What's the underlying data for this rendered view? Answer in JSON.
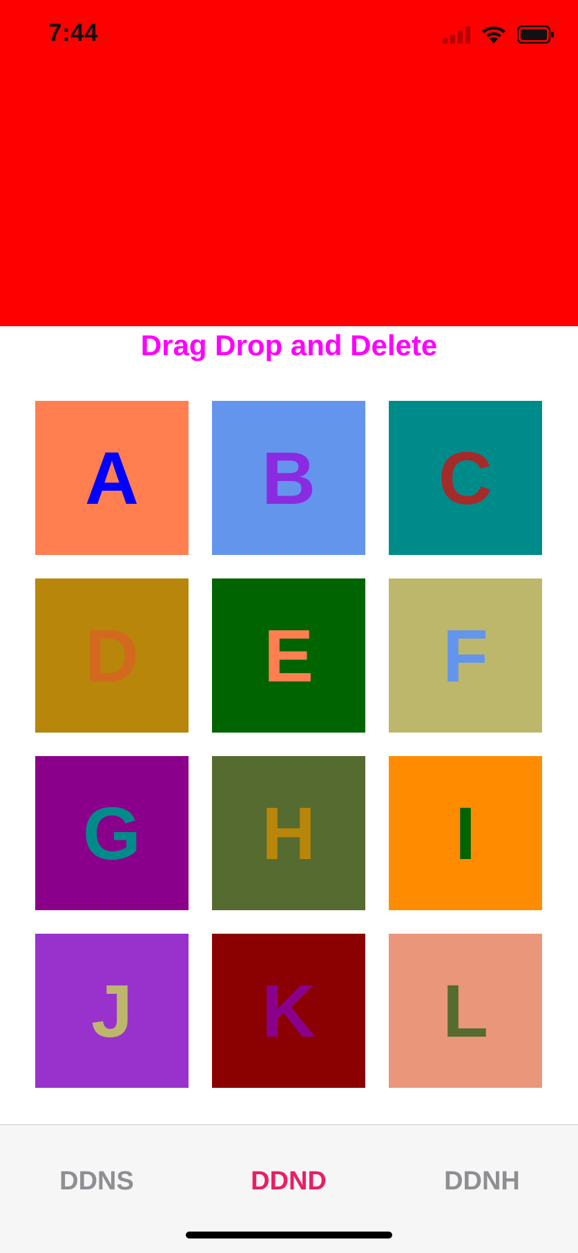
{
  "status_bar": {
    "time": "7:44",
    "icons": [
      "cellular-signal-icon",
      "wifi-icon",
      "battery-icon"
    ]
  },
  "header": {
    "color": "#ff0000"
  },
  "title": {
    "text": "Drag Drop and Delete",
    "color": "#ff00ff"
  },
  "tiles": [
    {
      "letter": "A",
      "bg": "#ff7f50",
      "fg": "#0000ff"
    },
    {
      "letter": "B",
      "bg": "#6495ed",
      "fg": "#8a2be2"
    },
    {
      "letter": "C",
      "bg": "#008b8b",
      "fg": "#a52a2a"
    },
    {
      "letter": "D",
      "bg": "#b8860b",
      "fg": "#d2691e"
    },
    {
      "letter": "E",
      "bg": "#006400",
      "fg": "#ff7f50"
    },
    {
      "letter": "F",
      "bg": "#bdb76b",
      "fg": "#6495ed"
    },
    {
      "letter": "G",
      "bg": "#8b008b",
      "fg": "#008b8b"
    },
    {
      "letter": "H",
      "bg": "#556b2f",
      "fg": "#b8860b"
    },
    {
      "letter": "I",
      "bg": "#ff8c00",
      "fg": "#006400"
    },
    {
      "letter": "J",
      "bg": "#9932cc",
      "fg": "#bdb76b"
    },
    {
      "letter": "K",
      "bg": "#8b0000",
      "fg": "#8b008b"
    },
    {
      "letter": "L",
      "bg": "#e9967a",
      "fg": "#556b2f"
    }
  ],
  "tabs": [
    {
      "label": "DDNS",
      "active": false
    },
    {
      "label": "DDND",
      "active": true
    },
    {
      "label": "DDNH",
      "active": false
    }
  ],
  "colors": {
    "tab_active": "#e91e63",
    "tab_inactive": "#8e8e93",
    "tabbar_bg": "#f6f6f6"
  }
}
